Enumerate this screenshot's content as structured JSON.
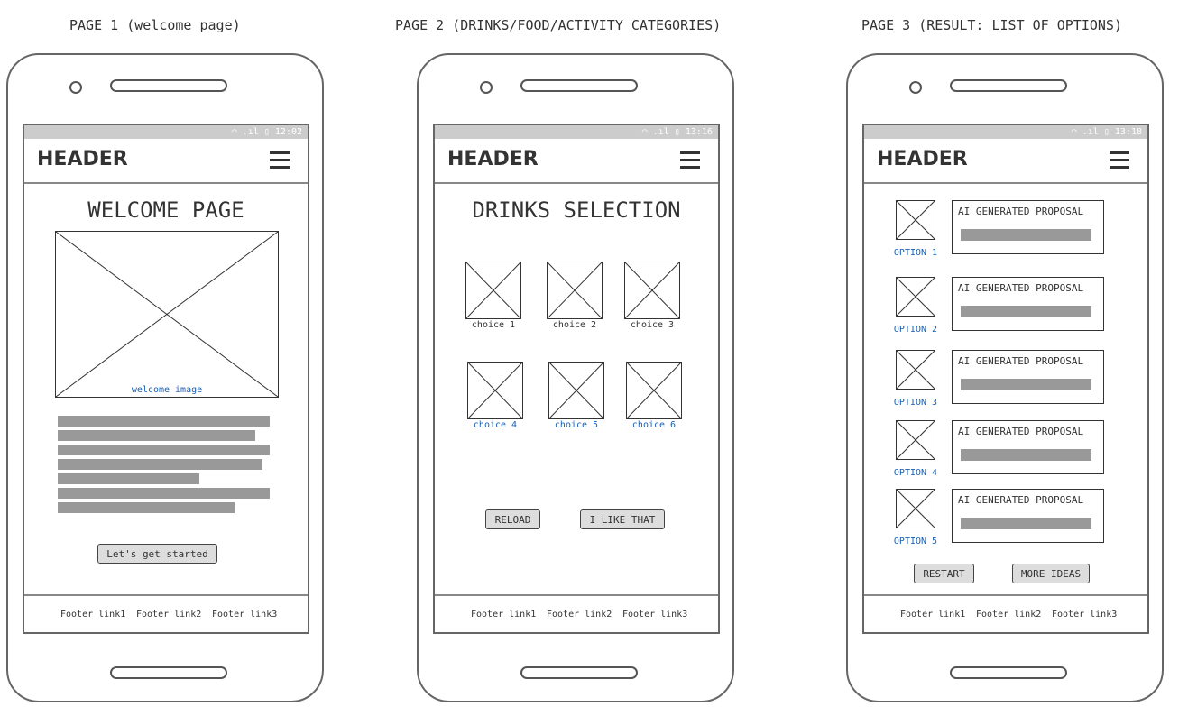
{
  "captions": [
    "PAGE 1 (welcome page)",
    "PAGE 2 (DRINKS/FOOD/ACTIVITY CATEGORIES)",
    "PAGE 3 (RESULT: LIST OF OPTIONS)"
  ],
  "header": "HEADER",
  "times": [
    "12:02",
    "13:16",
    "13:18"
  ],
  "footer_links": [
    "Footer link1",
    "Footer link2",
    "Footer link3"
  ],
  "page1": {
    "title": "WELCOME PAGE",
    "image_caption": "welcome image",
    "button": "Let's get started"
  },
  "page2": {
    "title": "DRINKS SELECTION",
    "choices": [
      "choice 1",
      "choice 2",
      "choice 3",
      "choice 4",
      "choice 5",
      "choice 6"
    ],
    "reload": "RELOAD",
    "like": "I LIKE THAT"
  },
  "page3": {
    "options": [
      "OPTION 1",
      "OPTION 2",
      "OPTION 3",
      "OPTION 4",
      "OPTION 5"
    ],
    "proposal": "AI GENERATED PROPOSAL",
    "restart": "RESTART",
    "more": "MORE IDEAS"
  }
}
